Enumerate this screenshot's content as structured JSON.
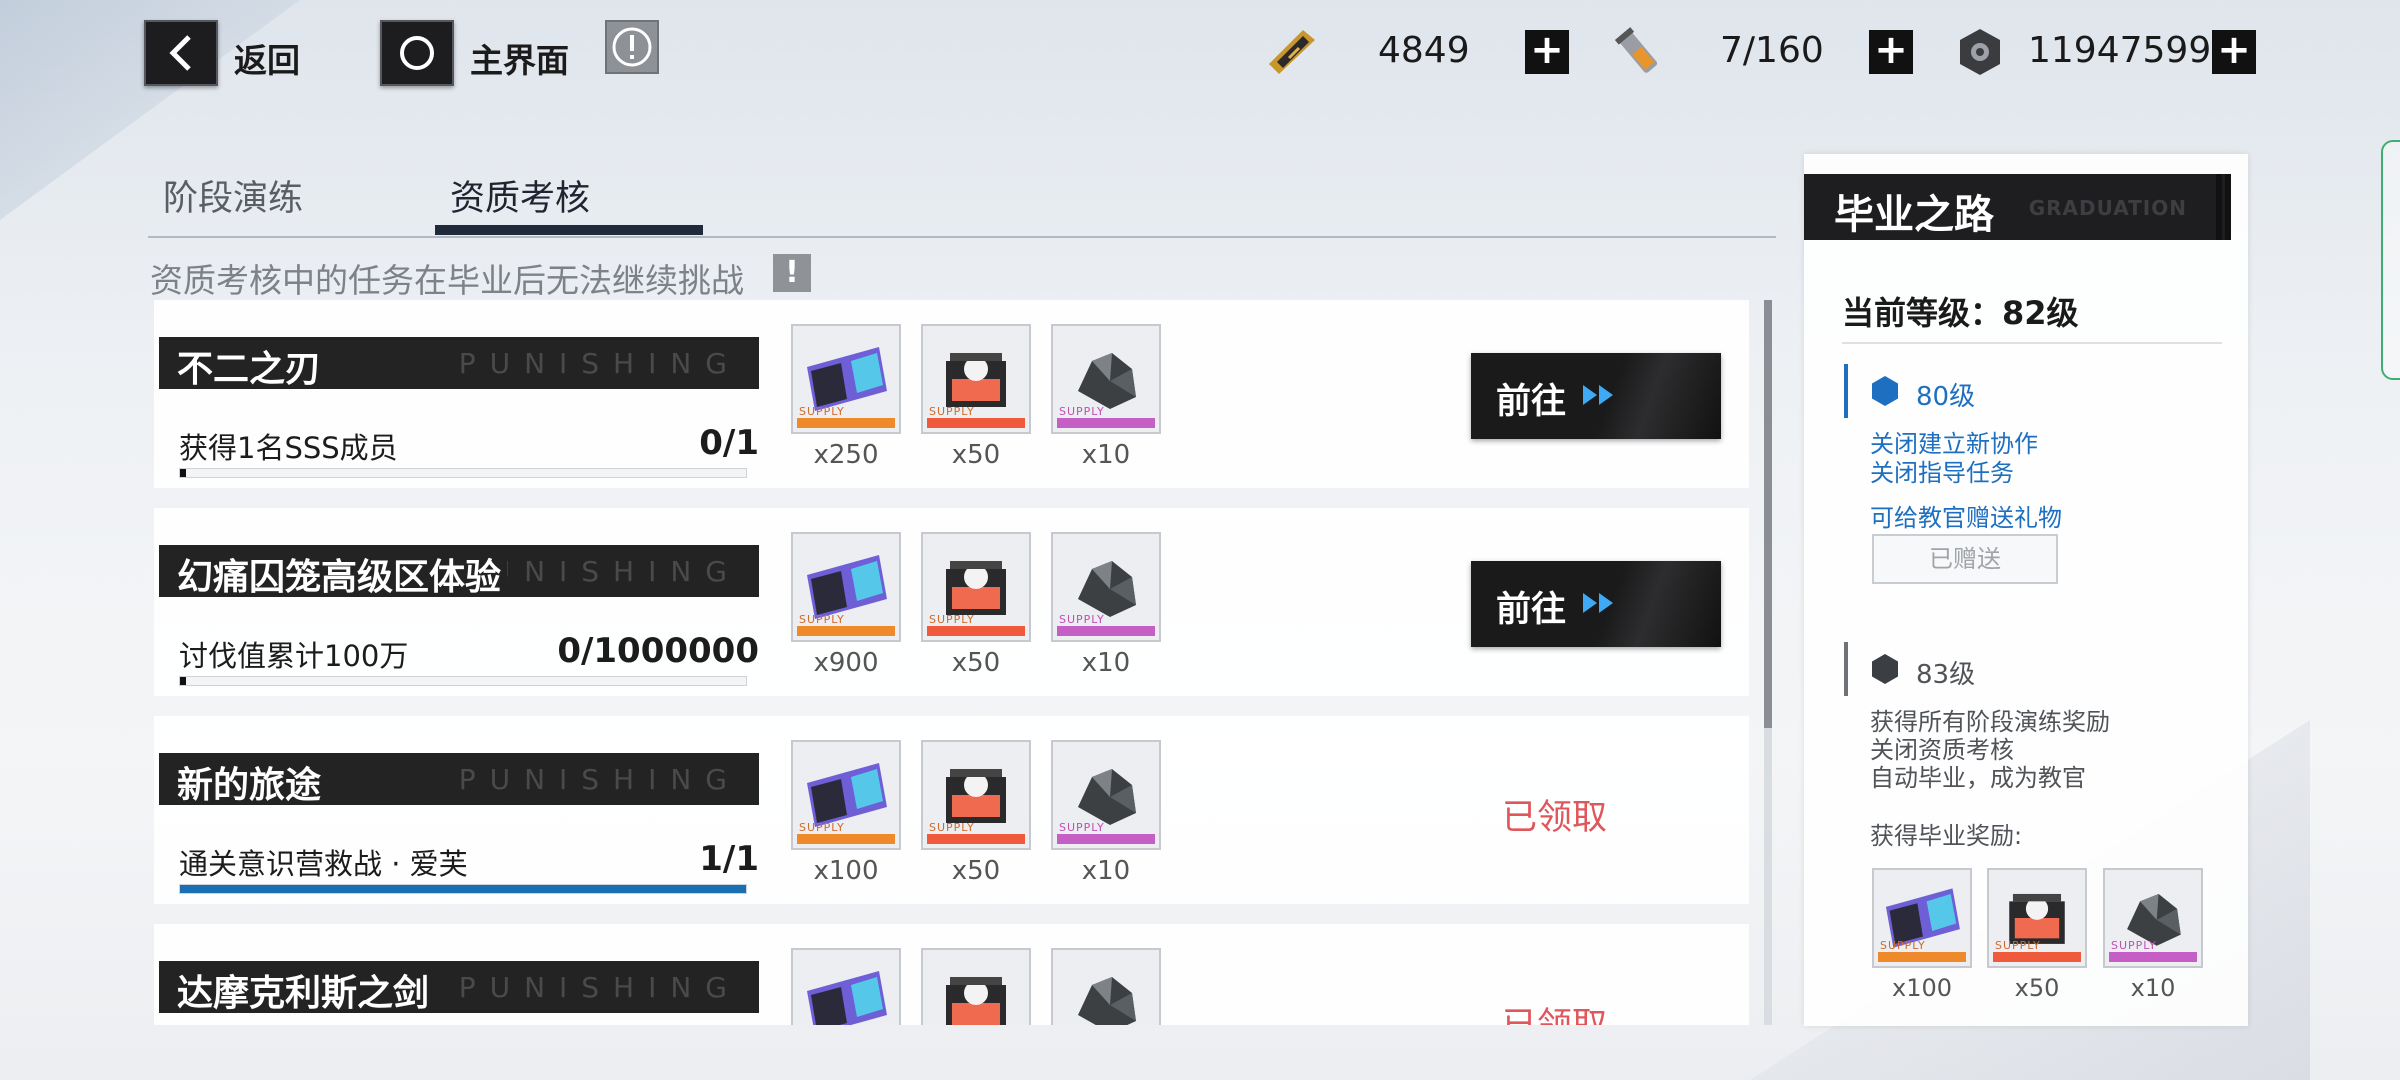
{
  "top_bar": {
    "back_label": "返回",
    "home_label": "主界面",
    "info_mark": "!",
    "resources": [
      {
        "icon": "stamina-card-icon",
        "value": "4849",
        "plus": "+"
      },
      {
        "icon": "serum-vial-icon",
        "value": "7/160",
        "plus": "+"
      },
      {
        "icon": "cog-coin-icon",
        "value": "11947599",
        "plus": "+"
      }
    ]
  },
  "tabs": [
    {
      "label": "阶段演练",
      "active": false
    },
    {
      "label": "资质考核",
      "active": true
    }
  ],
  "notice": {
    "text": "资质考核中的任务在毕业后无法继续挑战",
    "mark": "!"
  },
  "tasks": [
    {
      "title": "不二之刃",
      "watermark": "PUNISHING",
      "desc": "获得1名SSS成员",
      "progress": "0/1",
      "progress_fraction": 0.0,
      "rewards": [
        {
          "icon": "supply-ticket-icon",
          "qty": "x250"
        },
        {
          "icon": "supply-chip-icon",
          "qty": "x50"
        },
        {
          "icon": "supply-ore-icon",
          "qty": "x10"
        }
      ],
      "action": {
        "type": "go",
        "label": "前往"
      }
    },
    {
      "title": "幻痛囚笼高级区体验",
      "watermark": "PUNISHING",
      "desc": "讨伐值累计100万",
      "progress": "0/1000000",
      "progress_fraction": 0.0,
      "rewards": [
        {
          "icon": "supply-ticket-icon",
          "qty": "x900"
        },
        {
          "icon": "supply-chip-icon",
          "qty": "x50"
        },
        {
          "icon": "supply-ore-icon",
          "qty": "x10"
        }
      ],
      "action": {
        "type": "go",
        "label": "前往"
      }
    },
    {
      "title": "新的旅途",
      "watermark": "PUNISHING",
      "desc": "通关意识营救战 · 爱芙",
      "progress": "1/1",
      "progress_fraction": 1.0,
      "rewards": [
        {
          "icon": "supply-ticket-icon",
          "qty": "x100"
        },
        {
          "icon": "supply-chip-icon",
          "qty": "x50"
        },
        {
          "icon": "supply-ore-icon",
          "qty": "x10"
        }
      ],
      "action": {
        "type": "claimed",
        "label": "已领取"
      }
    },
    {
      "title": "达摩克利斯之剑",
      "watermark": "PUNISHING",
      "desc": "",
      "progress": "",
      "progress_fraction": null,
      "rewards": [
        {
          "icon": "supply-ticket-icon",
          "qty": ""
        },
        {
          "icon": "supply-chip-icon",
          "qty": ""
        },
        {
          "icon": "supply-ore-icon",
          "qty": ""
        }
      ],
      "action": {
        "type": "claimed",
        "label": "已领取"
      }
    }
  ],
  "panel": {
    "title": "毕业之路",
    "subtitle": "GRADUATION",
    "current_level": "当前等级：82级",
    "tiers": [
      {
        "level": "80级",
        "lines": [
          "关闭建立新协作",
          "关闭指导任务"
        ],
        "gift_text": "可给教官赠送礼物",
        "gift_button": "已赠送"
      },
      {
        "level": "83级",
        "lines": [
          "获得所有阶段演练奖励",
          "关闭资质考核",
          "自动毕业，成为教官"
        ],
        "reward_header": "获得毕业奖励:"
      }
    ],
    "graduation_rewards": [
      {
        "icon": "supply-ticket-icon",
        "qty": "x100"
      },
      {
        "icon": "supply-chip-icon",
        "qty": "x50"
      },
      {
        "icon": "supply-ore-icon",
        "qty": "x10"
      }
    ]
  },
  "colors": {
    "accent_blue": "#1e6fc0",
    "claimed_red": "#e0575b",
    "progress_blue": "#1a6fb3",
    "dark_panel": "#1e1e20"
  }
}
